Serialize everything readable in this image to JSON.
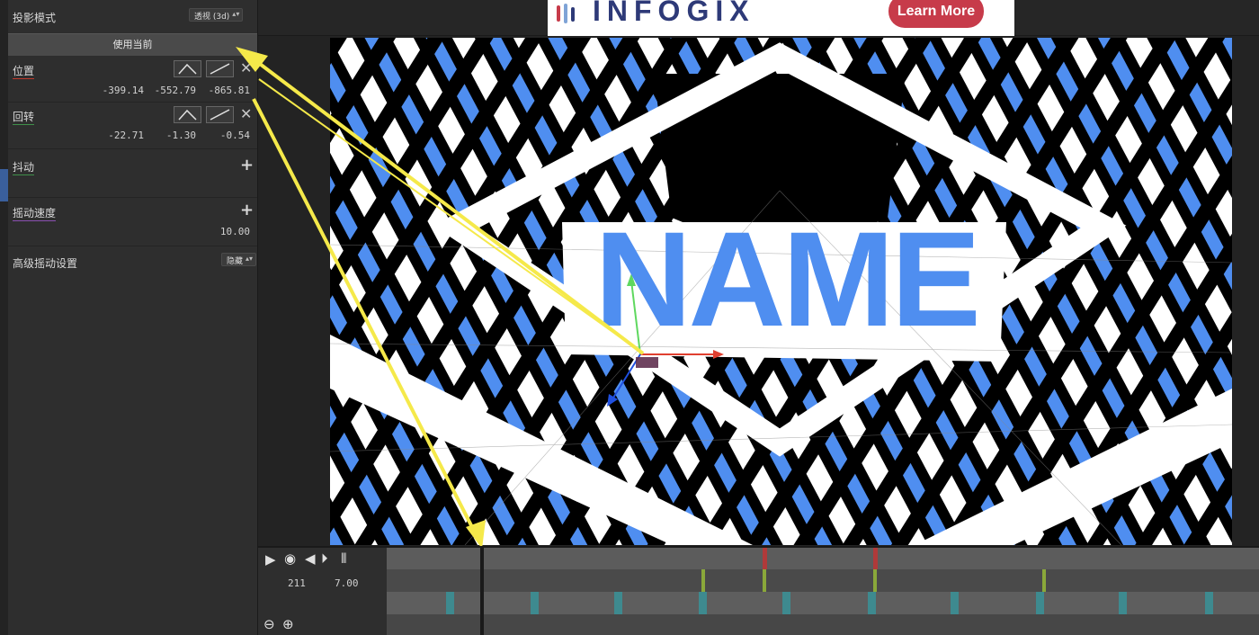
{
  "props": {
    "projection": {
      "label": "投影模式",
      "value": "透视 (3d)"
    },
    "use_current": "使用当前",
    "position": {
      "label": "位置",
      "x": "-399.14",
      "y": "-552.79",
      "z": "-865.81"
    },
    "rotation": {
      "label": "回转",
      "x": "-22.71",
      "y": "-1.30",
      "z": "-0.54"
    },
    "shake": {
      "label": "抖动"
    },
    "shake_speed": {
      "label": "摇动速度",
      "value": "10.00"
    },
    "advanced": {
      "label": "高级摇动设置",
      "value": "隐藏"
    }
  },
  "ad": {
    "brand": "INFOGIX",
    "cta": "Learn More"
  },
  "canvas": {
    "headline": "NAME"
  },
  "timeline": {
    "frame": "211",
    "time": "7.00"
  },
  "colors": {
    "accent_blue": "#4f8ef0",
    "ad_red": "#c73b4a",
    "ad_navy": "#2e3a78",
    "arrow_yellow": "#f5e94a"
  }
}
